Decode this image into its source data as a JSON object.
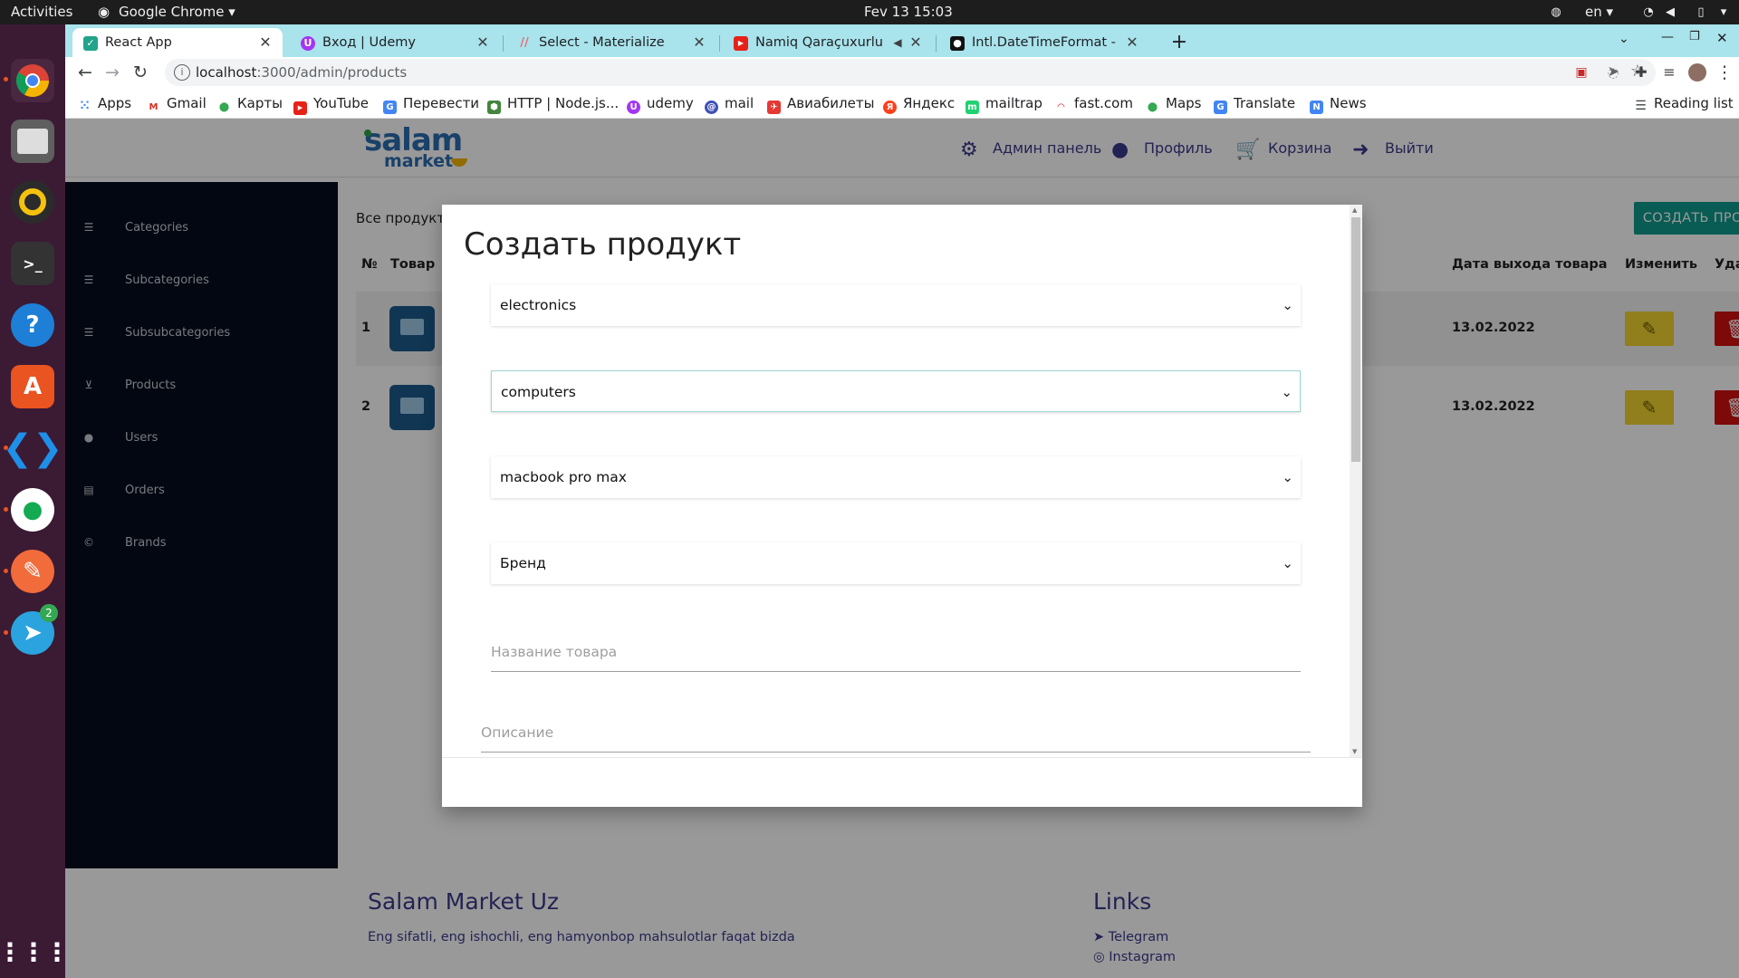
{
  "system": {
    "activities": "Activities",
    "app_name": "Google Chrome",
    "clock": "Fev 13  15:03",
    "language": "en"
  },
  "dock": {
    "telegram_badge": "2"
  },
  "browser": {
    "tabs": [
      {
        "title": "React App",
        "active": true
      },
      {
        "title": "Вход | Udemy"
      },
      {
        "title": "Select - Materialize"
      },
      {
        "title": "Namiq Qaraçuxurlu - R"
      },
      {
        "title": "Intl.DateTimeFormat - Jav"
      }
    ],
    "url_host": "localhost",
    "url_path": ":3000/admin/products",
    "bookmarks": [
      {
        "label": "Apps"
      },
      {
        "label": "Gmail"
      },
      {
        "label": "Карты"
      },
      {
        "label": "YouTube"
      },
      {
        "label": "Перевести"
      },
      {
        "label": "HTTP | Node.js..."
      },
      {
        "label": "udemy"
      },
      {
        "label": "mail"
      },
      {
        "label": "Авиабилеты"
      },
      {
        "label": "Яндекс"
      },
      {
        "label": "mailtrap"
      },
      {
        "label": "fast.com"
      },
      {
        "label": "Maps"
      },
      {
        "label": "Translate"
      },
      {
        "label": "News"
      }
    ],
    "reading_list": "Reading list"
  },
  "site": {
    "logo_top": "salam",
    "logo_bottom": "market",
    "nav": {
      "admin": "Админ панель",
      "profile": "Профиль",
      "cart": "Корзина",
      "logout": "Выйти"
    },
    "sidebar": [
      {
        "label": "Categories"
      },
      {
        "label": "Subcategories"
      },
      {
        "label": "Subsubcategories"
      },
      {
        "label": "Products"
      },
      {
        "label": "Users"
      },
      {
        "label": "Orders"
      },
      {
        "label": "Brands"
      }
    ],
    "content_title": "Все продукты",
    "create_button": "СОЗДАТЬ ПРОДУКТ",
    "table": {
      "headers": {
        "num": "№",
        "product": "Товар",
        "release_date": "Дата выхода товара",
        "edit": "Изменить",
        "delete": "Удалить"
      },
      "rows": [
        {
          "num": "1",
          "release_date": "13.02.2022"
        },
        {
          "num": "2",
          "release_date": "13.02.2022"
        }
      ]
    },
    "footer": {
      "brand_title": "Salam Market Uz",
      "tagline": "Eng sifatli, eng ishochli, eng hamyonbop mahsulotlar faqat bizda",
      "links_title": "Links",
      "telegram": "Telegram",
      "instagram": "Instagram"
    }
  },
  "modal": {
    "title": "Создать продукт",
    "category_value": "electronics",
    "subcategory_value": "computers",
    "subsubcategory_value": "macbook pro max",
    "brand_placeholder": "Бренд",
    "name_placeholder": "Название товара",
    "description_placeholder": "Описание"
  },
  "colors": {
    "accent_teal": "#0e9a8c",
    "nav_indigo": "#3b3a8c",
    "edit_yellow": "#f2d230",
    "delete_red": "#d10f0f",
    "sidebar_bg": "#050c1d",
    "tabstrip_bg": "#a9e3ec"
  }
}
